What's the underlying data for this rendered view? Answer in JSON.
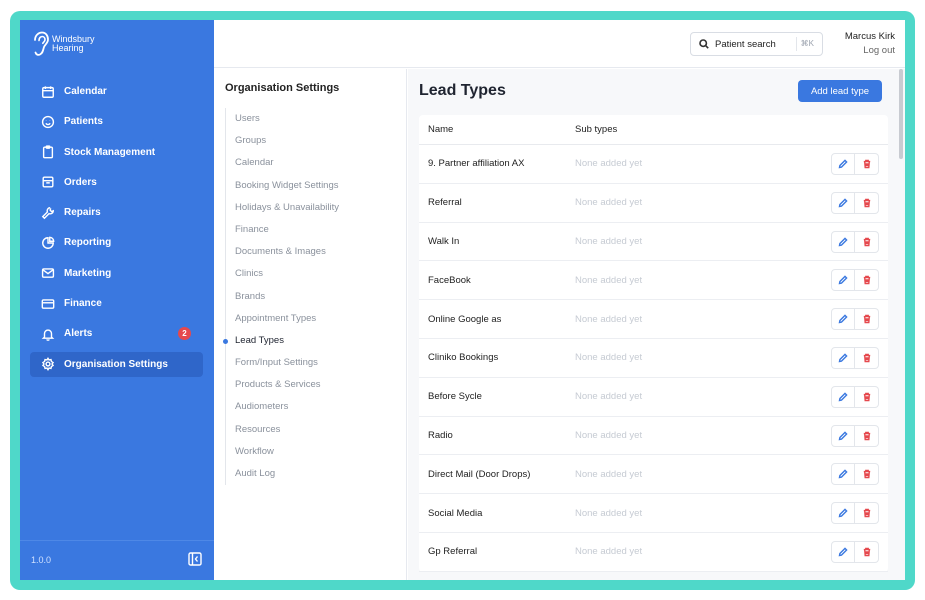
{
  "brand": {
    "line1": "Windsbury",
    "line2": "Hearing"
  },
  "sidebar": {
    "items": [
      {
        "label": "Calendar",
        "icon": "calendar-icon"
      },
      {
        "label": "Patients",
        "icon": "smile-icon"
      },
      {
        "label": "Stock Management",
        "icon": "clipboard-icon"
      },
      {
        "label": "Orders",
        "icon": "inbox-icon"
      },
      {
        "label": "Repairs",
        "icon": "wrench-icon"
      },
      {
        "label": "Reporting",
        "icon": "pie-chart-icon"
      },
      {
        "label": "Marketing",
        "icon": "mail-icon"
      },
      {
        "label": "Finance",
        "icon": "credit-card-icon"
      },
      {
        "label": "Alerts",
        "icon": "bell-icon",
        "badge": "2"
      },
      {
        "label": "Organisation Settings",
        "icon": "gear-icon",
        "active": true
      }
    ],
    "version": "1.0.0"
  },
  "topbar": {
    "search_label": "Patient search",
    "search_shortcut": "⌘K",
    "user_name": "Marcus Kirk",
    "logout_label": "Log out"
  },
  "settings_nav": {
    "title": "Organisation Settings",
    "items": [
      "Users",
      "Groups",
      "Calendar",
      "Booking Widget Settings",
      "Holidays & Unavailability",
      "Finance",
      "Documents & Images",
      "Clinics",
      "Brands",
      "Appointment Types",
      "Lead Types",
      "Form/Input Settings",
      "Products & Services",
      "Audiometers",
      "Resources",
      "Workflow",
      "Audit Log"
    ],
    "active": "Lead Types"
  },
  "content": {
    "title": "Lead Types",
    "add_button": "Add lead type",
    "columns": {
      "name": "Name",
      "sub_types": "Sub types"
    },
    "rows": [
      {
        "name": "9. Partner affiliation AX",
        "sub_types": "None added yet"
      },
      {
        "name": "Referral",
        "sub_types": "None added yet"
      },
      {
        "name": "Walk In",
        "sub_types": "None added yet"
      },
      {
        "name": "FaceBook",
        "sub_types": "None added yet"
      },
      {
        "name": "Online Google as",
        "sub_types": "None added yet"
      },
      {
        "name": "Cliniko Bookings",
        "sub_types": "None added yet"
      },
      {
        "name": "Before Sycle",
        "sub_types": "None added yet"
      },
      {
        "name": "Radio",
        "sub_types": "None added yet"
      },
      {
        "name": "Direct Mail (Door Drops)",
        "sub_types": "None added yet"
      },
      {
        "name": "Social Media",
        "sub_types": "None added yet"
      },
      {
        "name": "Gp Referral",
        "sub_types": "None added yet"
      }
    ]
  },
  "colors": {
    "primary": "#3a78e0",
    "frame": "#4fd8c9",
    "danger": "#e5484d"
  }
}
